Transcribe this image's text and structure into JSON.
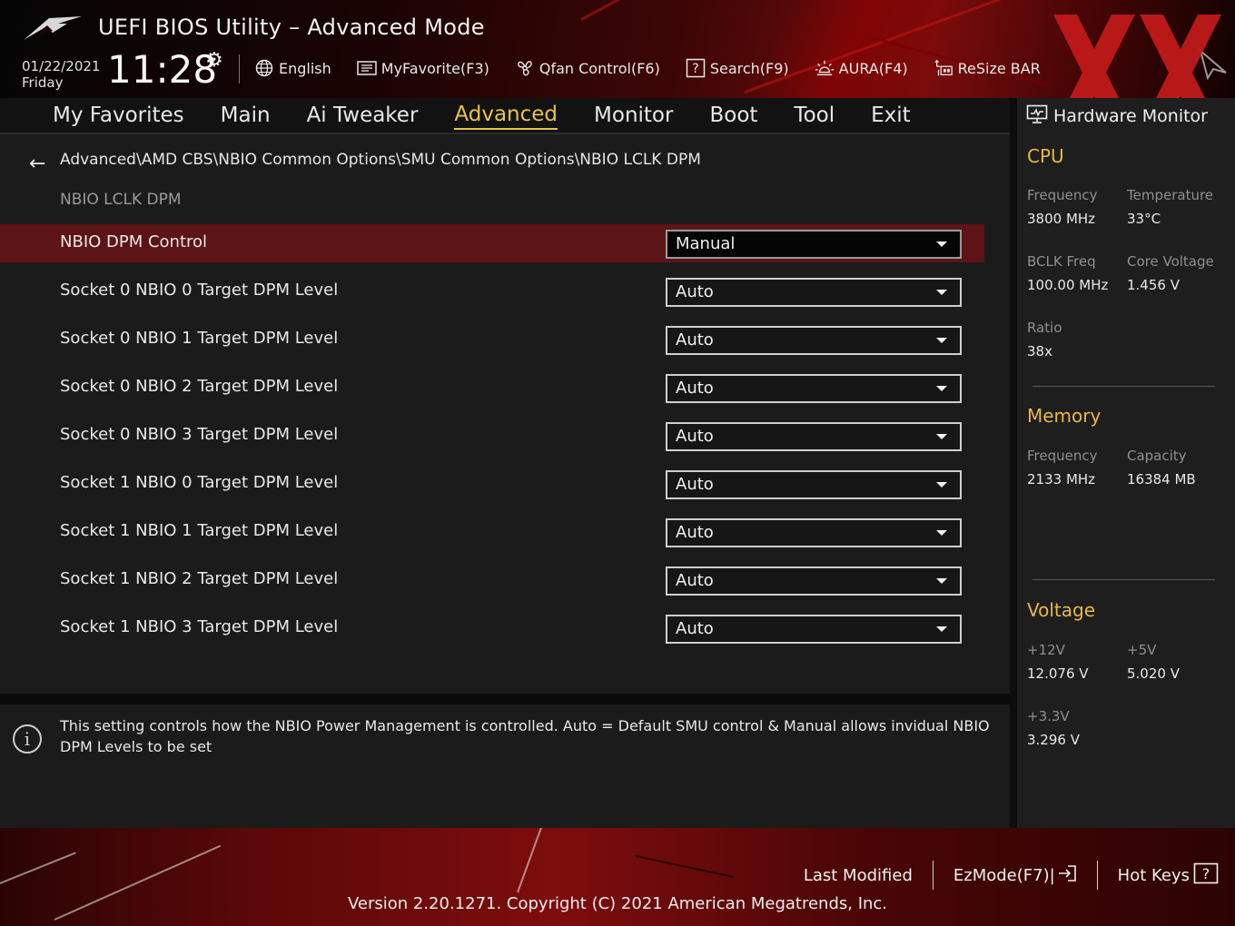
{
  "header": {
    "title": "UEFI BIOS Utility – Advanced Mode",
    "date": "01/22/2021",
    "day": "Friday",
    "time": "11:28",
    "toolbar": [
      {
        "label": "English",
        "icon": "globe-icon"
      },
      {
        "label": "MyFavorite(F3)",
        "icon": "favorite-list-icon"
      },
      {
        "label": "Qfan Control(F6)",
        "icon": "fan-icon"
      },
      {
        "label": "Search(F9)",
        "icon": "search-help-icon"
      },
      {
        "label": "AURA(F4)",
        "icon": "aura-light-icon"
      },
      {
        "label": "ReSize BAR",
        "icon": "resize-bar-icon"
      }
    ]
  },
  "tabs": [
    {
      "label": "My Favorites",
      "active": false
    },
    {
      "label": "Main",
      "active": false
    },
    {
      "label": "Ai Tweaker",
      "active": false
    },
    {
      "label": "Advanced",
      "active": true
    },
    {
      "label": "Monitor",
      "active": false
    },
    {
      "label": "Boot",
      "active": false
    },
    {
      "label": "Tool",
      "active": false
    },
    {
      "label": "Exit",
      "active": false
    }
  ],
  "breadcrumb": "Advanced\\AMD CBS\\NBIO Common Options\\SMU Common Options\\NBIO LCLK DPM",
  "section_title": "NBIO LCLK DPM",
  "settings": [
    {
      "label": "NBIO DPM Control",
      "value": "Manual",
      "selected": true
    },
    {
      "label": "Socket 0 NBIO 0 Target DPM Level",
      "value": "Auto",
      "selected": false
    },
    {
      "label": "Socket 0 NBIO 1 Target DPM Level",
      "value": "Auto",
      "selected": false
    },
    {
      "label": "Socket 0 NBIO 2 Target DPM Level",
      "value": "Auto",
      "selected": false
    },
    {
      "label": "Socket 0 NBIO 3 Target DPM Level",
      "value": "Auto",
      "selected": false
    },
    {
      "label": "Socket 1 NBIO 0 Target DPM Level",
      "value": "Auto",
      "selected": false
    },
    {
      "label": "Socket 1 NBIO 1 Target DPM Level",
      "value": "Auto",
      "selected": false
    },
    {
      "label": "Socket 1 NBIO 2 Target DPM Level",
      "value": "Auto",
      "selected": false
    },
    {
      "label": "Socket 1 NBIO 3 Target DPM Level",
      "value": "Auto",
      "selected": false
    }
  ],
  "info_text": "This setting controls how the NBIO Power Management is controlled. Auto = Default SMU control & Manual allows invidual NBIO DPM Levels to be set",
  "hardware_monitor": {
    "title": "Hardware Monitor",
    "cpu": {
      "heading": "CPU",
      "frequency_label": "Frequency",
      "frequency": "3800 MHz",
      "temperature_label": "Temperature",
      "temperature": "33°C",
      "bclk_label": "BCLK Freq",
      "bclk": "100.00 MHz",
      "core_voltage_label": "Core Voltage",
      "core_voltage": "1.456 V",
      "ratio_label": "Ratio",
      "ratio": "38x"
    },
    "memory": {
      "heading": "Memory",
      "frequency_label": "Frequency",
      "frequency": "2133 MHz",
      "capacity_label": "Capacity",
      "capacity": "16384 MB"
    },
    "voltage": {
      "heading": "Voltage",
      "v12_label": "+12V",
      "v12": "12.076 V",
      "v5_label": "+5V",
      "v5": "5.020 V",
      "v33_label": "+3.3V",
      "v33": "3.296 V"
    }
  },
  "footer": {
    "last_modified": "Last Modified",
    "ezmode": "EzMode(F7)|",
    "hot_keys": "Hot Keys",
    "version": "Version 2.20.1271. Copyright (C) 2021 American Megatrends, Inc."
  },
  "colors": {
    "accent": "#e8c34a",
    "selected_row": "#5c1416",
    "brand_red": "#b01818"
  }
}
